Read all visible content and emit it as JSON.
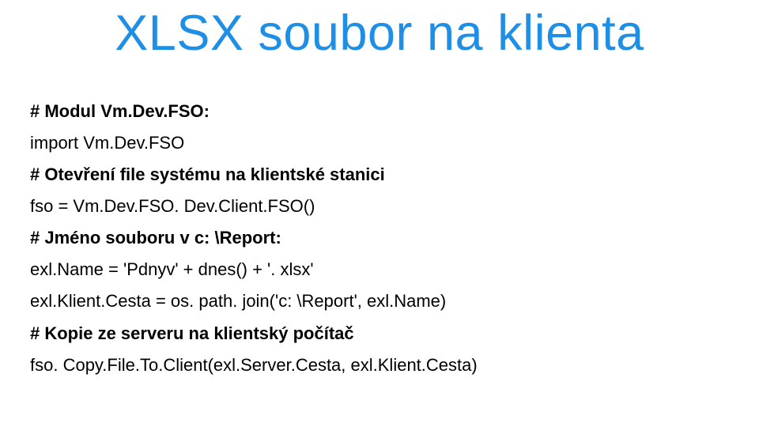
{
  "title": "XLSX soubor na klienta",
  "lines": {
    "l1": "# Modul Vm.Dev.FSO:",
    "l2": "import Vm.Dev.FSO",
    "l3": "# Otevření file systému na klientské stanici",
    "l4": "fso = Vm.Dev.FSO. Dev.Client.FSO()",
    "l5": "# Jméno souboru v c: \\Report:",
    "l6": "exl.Name = 'Pdnyv' + dnes() + '. xlsx'",
    "l7": "exl.Klient.Cesta = os. path. join('c: \\Report', exl.Name)",
    "l8": "# Kopie ze serveru na klientský počítač",
    "l9": "fso. Copy.File.To.Client(exl.Server.Cesta, exl.Klient.Cesta)"
  }
}
